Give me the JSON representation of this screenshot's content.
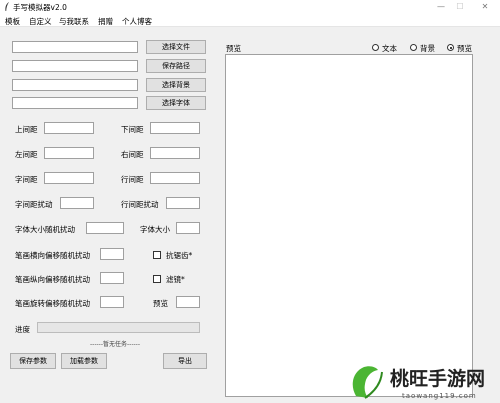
{
  "window": {
    "title": "手写模拟器v2.0"
  },
  "menu": [
    "模板",
    "自定义",
    "与我联系",
    "捐赠",
    "个人博客"
  ],
  "file_buttons": [
    "选择文件",
    "保存路径",
    "选择背景",
    "选择字体"
  ],
  "params": {
    "top_margin": "上间距",
    "bottom_margin": "下间距",
    "left_margin": "左间距",
    "right_margin": "右间距",
    "char_spacing": "字间距",
    "line_spacing": "行间距",
    "char_spacing_jitter": "字间距扰动",
    "line_spacing_jitter": "行间距扰动",
    "font_size_jitter": "字体大小随机扰动",
    "font_size": "字体大小",
    "stroke_h_jitter": "笔画横向偏移随机扰动",
    "stroke_v_jitter": "笔画纵向偏移随机扰动",
    "stroke_rot_jitter": "笔画旋转偏移随机扰动",
    "antialias": "抗锯齿*",
    "filter": "滤镜*",
    "preview": "预览"
  },
  "progress": {
    "label": "进度",
    "status": "------暂无任务------"
  },
  "actions": {
    "save": "保存参数",
    "load": "加载参数",
    "export": "导出"
  },
  "preview_panel": {
    "label": "预览",
    "modes": [
      "文本",
      "背景",
      "预览"
    ],
    "selected_mode": "预览"
  },
  "watermark": {
    "name": "桃旺手游网",
    "url": "taowang119.com",
    "color": "#4bb533"
  }
}
